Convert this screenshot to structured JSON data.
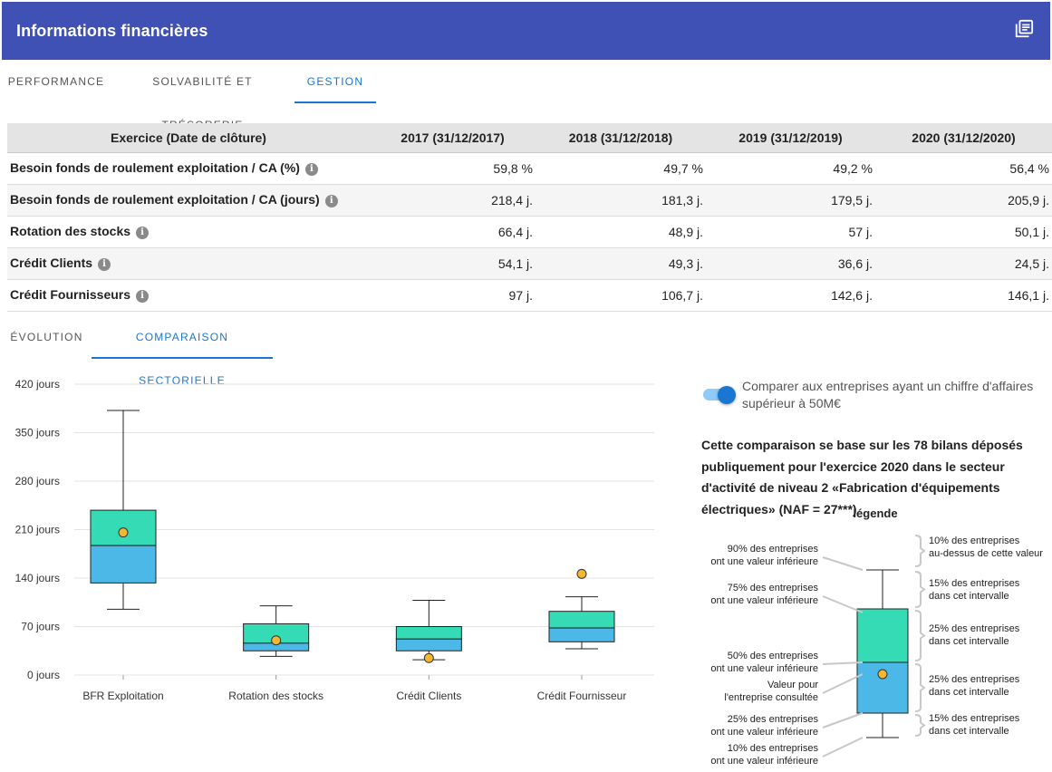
{
  "header": {
    "title": "Informations financières",
    "icon": "library-books-icon"
  },
  "main_tabs": [
    {
      "label": "PERFORMANCE",
      "active": false
    },
    {
      "label": "SOLVABILITÉ ET TRÉSORERIE",
      "active": false
    },
    {
      "label": "GESTION",
      "active": true
    }
  ],
  "table": {
    "headers": [
      "Exercice (Date de clôture)",
      "2017 (31/12/2017)",
      "2018 (31/12/2018)",
      "2019 (31/12/2019)",
      "2020 (31/12/2020)"
    ],
    "rows": [
      {
        "label": "Besoin fonds de roulement exploitation / CA (%)",
        "values": [
          "59,8 %",
          "49,7 %",
          "49,2 %",
          "56,4 %"
        ]
      },
      {
        "label": "Besoin fonds de roulement exploitation / CA (jours)",
        "values": [
          "218,4 j.",
          "181,3 j.",
          "179,5 j.",
          "205,9 j."
        ]
      },
      {
        "label": "Rotation des stocks",
        "values": [
          "66,4 j.",
          "48,9 j.",
          "57 j.",
          "50,1 j."
        ]
      },
      {
        "label": "Crédit Clients",
        "values": [
          "54,1 j.",
          "49,3 j.",
          "36,6 j.",
          "24,5 j."
        ]
      },
      {
        "label": "Crédit Fournisseurs",
        "values": [
          "97 j.",
          "106,7 j.",
          "142,6 j.",
          "146,1 j."
        ]
      }
    ]
  },
  "sub_tabs": [
    {
      "label": "ÉVOLUTION",
      "active": false
    },
    {
      "label": "COMPARAISON SECTORIELLE",
      "active": true
    }
  ],
  "chart_data": {
    "type": "boxplot",
    "y_tick_labels": [
      "0 jours",
      "70 jours",
      "140 jours",
      "210 jours",
      "280 jours",
      "350 jours",
      "420 jours"
    ],
    "y_ticks": [
      0,
      70,
      140,
      210,
      280,
      350,
      420
    ],
    "ylim": [
      0,
      420
    ],
    "grid": true,
    "categories": [
      "BFR Exploitation",
      "Rotation des stocks",
      "Crédit Clients",
      "Crédit Fournisseur"
    ],
    "boxes": [
      {
        "p10": 95,
        "p25": 133,
        "median": 187,
        "p75": 238,
        "p90": 382,
        "company": 205.9
      },
      {
        "p10": 27,
        "p25": 35,
        "median": 46,
        "p75": 74,
        "p90": 100,
        "company": 50.1
      },
      {
        "p10": 22,
        "p25": 35,
        "median": 52,
        "p75": 70,
        "p90": 108,
        "company": 24.5
      },
      {
        "p10": 38,
        "p25": 48,
        "median": 68,
        "p75": 92,
        "p90": 113,
        "company": 146.1
      }
    ],
    "colors": {
      "upper_box": "#35dbb4",
      "lower_box": "#4cb8e8",
      "marker": "#f5b731",
      "grid": "#e3e3e3"
    }
  },
  "toggle": {
    "label": "Comparer aux entreprises ayant un chiffre d'affaires supérieur à 50M€",
    "on": true
  },
  "comparison_text": "Cette comparaison se base sur les 78 bilans déposés publiquement pour l'exercice 2020 dans le secteur d'activité de niveau 2 «Fabrication d'équipements électriques» (NAF = 27***)",
  "legend": {
    "title": "légende",
    "left": [
      [
        "90% des entreprises",
        "ont une valeur inférieure"
      ],
      [
        "75% des entreprises",
        "ont une valeur inférieure"
      ],
      [
        "50% des entreprises",
        "ont une valeur inférieure"
      ],
      [
        "Valeur pour",
        "l'entreprise consultée"
      ],
      [
        "25% des entreprises",
        "ont une valeur inférieure"
      ],
      [
        "10% des entreprises",
        "ont une valeur inférieure"
      ]
    ],
    "right": [
      [
        "10% des entreprises",
        "au-dessus de cette valeur"
      ],
      [
        "15% des entreprises",
        "dans cet intervalle"
      ],
      [
        "25% des entreprises",
        "dans cet intervalle"
      ],
      [
        "25% des entreprises",
        "dans cet intervalle"
      ],
      [
        "15% des entreprises",
        "dans cet intervalle"
      ]
    ]
  }
}
